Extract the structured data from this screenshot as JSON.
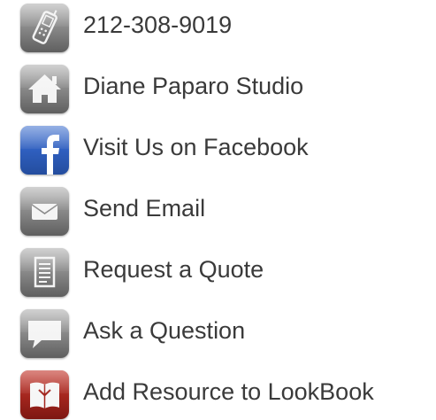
{
  "contact_list": {
    "items": [
      {
        "label": "212-308-9019",
        "icon": "phone-icon"
      },
      {
        "label": "Diane Paparo Studio",
        "icon": "home-icon"
      },
      {
        "label": "Visit Us on Facebook",
        "icon": "facebook-icon"
      },
      {
        "label": "Send Email",
        "icon": "email-icon"
      },
      {
        "label": "Request a Quote",
        "icon": "document-icon"
      },
      {
        "label": "Ask a Question",
        "icon": "speech-bubble-icon"
      },
      {
        "label": "Add Resource to LookBook",
        "icon": "lookbook-icon"
      }
    ]
  },
  "colors": {
    "text": "#3a3a3a",
    "facebook_blue": "#2f5fbf",
    "lookbook_red": "#a3251d",
    "icon_gray": "#8c8c8c"
  }
}
